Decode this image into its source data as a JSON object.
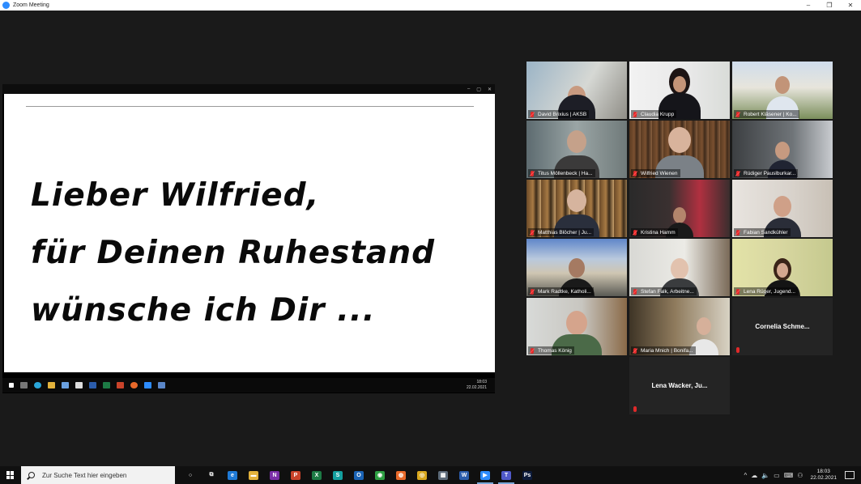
{
  "window": {
    "title": "Zoom Meeting",
    "controls": [
      "–",
      "❐",
      "✕"
    ]
  },
  "shared_screen": {
    "top_controls": [
      "–",
      "▢",
      "✕"
    ],
    "slide_lines": [
      "Lieber Wilfried,",
      "für Deinen Ruhestand",
      "wünsche ich Dir ..."
    ],
    "taskbar_time": "18:03",
    "taskbar_date": "22.02.2021"
  },
  "participants": [
    {
      "name": "David Brixius | AKSB",
      "video": true,
      "muted": true,
      "speaking": false
    },
    {
      "name": "Claudia Krupp",
      "video": true,
      "muted": true,
      "speaking": false
    },
    {
      "name": "Robert Kläsener | Ko...",
      "video": true,
      "muted": true,
      "speaking": true
    },
    {
      "name": "Titus Möllenbeck | Ha...",
      "video": true,
      "muted": true,
      "speaking": false
    },
    {
      "name": "Wilfried Wienen",
      "video": true,
      "muted": true,
      "speaking": false
    },
    {
      "name": "Rüdiger Pauslburkar...",
      "video": true,
      "muted": true,
      "speaking": false
    },
    {
      "name": "Matthias Blöcher | Ju...",
      "video": true,
      "muted": true,
      "speaking": false
    },
    {
      "name": "Kristina Hamm",
      "video": true,
      "muted": true,
      "speaking": false
    },
    {
      "name": "Fabian Sandkühler",
      "video": true,
      "muted": true,
      "speaking": false
    },
    {
      "name": "Mark Radtke, Katholi...",
      "video": true,
      "muted": true,
      "speaking": false
    },
    {
      "name": "Stefan Falk, Arbeitne...",
      "video": true,
      "muted": true,
      "speaking": false
    },
    {
      "name": "Lena Rüger, Jugend...",
      "video": true,
      "muted": true,
      "speaking": false
    },
    {
      "name": "Thomas König",
      "video": true,
      "muted": true,
      "speaking": false
    },
    {
      "name": "Maria Mnich | Bonifa...",
      "video": true,
      "muted": true,
      "speaking": false
    },
    {
      "name": "Cornelia Schme...",
      "video": false,
      "muted": true,
      "speaking": false
    },
    {
      "name": "Lena Wacker, Ju...",
      "video": false,
      "muted": true,
      "speaking": false
    }
  ],
  "taskbar": {
    "search_placeholder": "Zur Suche Text hier eingeben",
    "apps": [
      {
        "icon": "cortana-icon",
        "label": "○",
        "color": "#101010"
      },
      {
        "icon": "task-view-icon",
        "label": "⧉",
        "color": "#101010"
      },
      {
        "icon": "edge-icon",
        "label": "e",
        "color": "#1f7ad6"
      },
      {
        "icon": "file-explorer-icon",
        "label": "▬",
        "color": "#e3b23c"
      },
      {
        "icon": "onenote-icon",
        "label": "N",
        "color": "#7b2fa8"
      },
      {
        "icon": "powerpoint-icon",
        "label": "P",
        "color": "#c9432a"
      },
      {
        "icon": "excel-icon",
        "label": "X",
        "color": "#1d7a45"
      },
      {
        "icon": "sway-icon",
        "label": "S",
        "color": "#14a0a0"
      },
      {
        "icon": "outlook-icon",
        "label": "O",
        "color": "#1a63b5"
      },
      {
        "icon": "feedback-icon",
        "label": "◉",
        "color": "#2ea043"
      },
      {
        "icon": "firefox-icon",
        "label": "◍",
        "color": "#e8692a"
      },
      {
        "icon": "chrome-icon",
        "label": "◎",
        "color": "#d9a81f"
      },
      {
        "icon": "calculator-icon",
        "label": "▦",
        "color": "#5d6b7a"
      },
      {
        "icon": "word-icon",
        "label": "W",
        "color": "#2b5cab"
      },
      {
        "icon": "zoom-icon",
        "label": "▶",
        "color": "#2d8cff"
      },
      {
        "icon": "teams-icon",
        "label": "T",
        "color": "#5059c9"
      },
      {
        "icon": "photoshop-icon",
        "label": "Ps",
        "color": "#0d1b3a"
      }
    ],
    "active_apps": [
      "zoom-icon",
      "teams-icon"
    ],
    "tray_icons": [
      "^",
      "☁",
      "🔈",
      "▭",
      "⌨",
      "⚇"
    ],
    "time": "18:03",
    "date": "22.02.2021"
  },
  "colors": {
    "speaking_border": "#c9e33a",
    "muted_mic": "#e02a2a",
    "background": "#1a1a1a"
  }
}
